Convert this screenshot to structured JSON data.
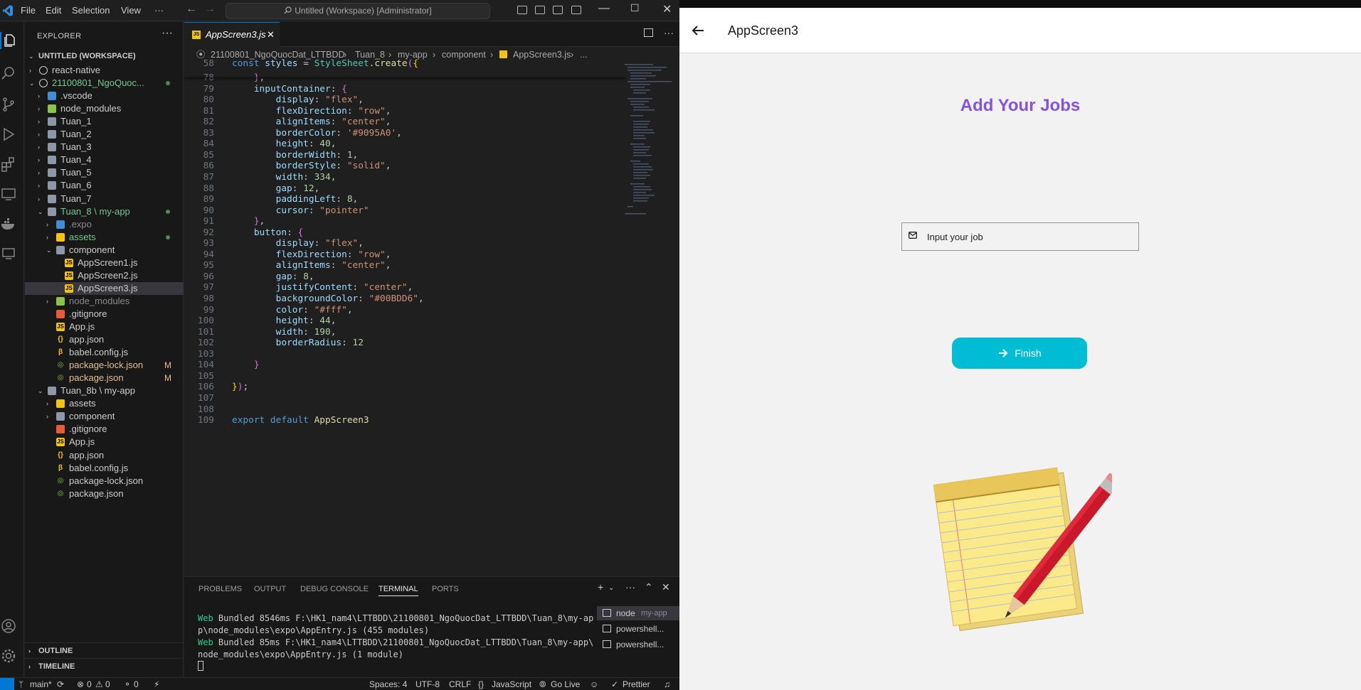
{
  "vscode": {
    "menu": [
      "File",
      "Edit",
      "Selection",
      "View",
      "···"
    ],
    "command_center": "Untitled (Workspace) [Administrator]",
    "explorer_title": "EXPLORER",
    "explorer_more": "···",
    "workspace_label": "UNTITLED (WORKSPACE)",
    "tree": [
      {
        "label": "react-native",
        "depth": 1,
        "chev": "›",
        "icon": "root"
      },
      {
        "label": "21100801_NgoQuoc...",
        "depth": 1,
        "chev": "⌄",
        "icon": "root",
        "dot": true,
        "color": "#73c991"
      },
      {
        "label": ".vscode",
        "depth": 2,
        "chev": "›",
        "icon": "vscode-folder"
      },
      {
        "label": "node_modules",
        "depth": 2,
        "chev": "›",
        "icon": "node-folder"
      },
      {
        "label": "Tuan_1",
        "depth": 2,
        "chev": "›",
        "icon": "folder"
      },
      {
        "label": "Tuan_2",
        "depth": 2,
        "chev": "›",
        "icon": "folder"
      },
      {
        "label": "Tuan_3",
        "depth": 2,
        "chev": "›",
        "icon": "folder"
      },
      {
        "label": "Tuan_4",
        "depth": 2,
        "chev": "›",
        "icon": "folder"
      },
      {
        "label": "Tuan_5",
        "depth": 2,
        "chev": "›",
        "icon": "folder"
      },
      {
        "label": "Tuan_6",
        "depth": 2,
        "chev": "›",
        "icon": "folder"
      },
      {
        "label": "Tuan_7",
        "depth": 2,
        "chev": "›",
        "icon": "folder"
      },
      {
        "label": "Tuan_8 \\ my-app",
        "depth": 2,
        "chev": "⌄",
        "icon": "folder-open",
        "dot": true,
        "color": "#73c991"
      },
      {
        "label": ".expo",
        "depth": 3,
        "chev": "›",
        "icon": "expo-folder",
        "color": "#8b8b8b"
      },
      {
        "label": "assets",
        "depth": 3,
        "chev": "›",
        "icon": "assets-folder",
        "dot": true,
        "color": "#73c991"
      },
      {
        "label": "component",
        "depth": 3,
        "chev": "⌄",
        "icon": "folder-open"
      },
      {
        "label": "AppScreen1.js",
        "depth": 4,
        "chev": "",
        "icon": "js"
      },
      {
        "label": "AppScreen2.js",
        "depth": 4,
        "chev": "",
        "icon": "js"
      },
      {
        "label": "AppScreen3.js",
        "depth": 4,
        "chev": "",
        "icon": "js",
        "selected": true
      },
      {
        "label": "node_modules",
        "depth": 3,
        "chev": "›",
        "icon": "node-folder",
        "color": "#8b8b8b"
      },
      {
        "label": ".gitignore",
        "depth": 3,
        "chev": "",
        "icon": "git"
      },
      {
        "label": "App.js",
        "depth": 3,
        "chev": "",
        "icon": "js"
      },
      {
        "label": "app.json",
        "depth": 3,
        "chev": "",
        "icon": "json"
      },
      {
        "label": "babel.config.js",
        "depth": 3,
        "chev": "",
        "icon": "babel"
      },
      {
        "label": "package-lock.json",
        "depth": 3,
        "chev": "",
        "icon": "npm",
        "mod": "M",
        "color": "#e2c08d"
      },
      {
        "label": "package.json",
        "depth": 3,
        "chev": "",
        "icon": "npm",
        "mod": "M",
        "color": "#e2c08d"
      },
      {
        "label": "Tuan_8b \\ my-app",
        "depth": 2,
        "chev": "⌄",
        "icon": "folder-open"
      },
      {
        "label": "assets",
        "depth": 3,
        "chev": "›",
        "icon": "assets-folder"
      },
      {
        "label": "component",
        "depth": 3,
        "chev": "›",
        "icon": "folder"
      },
      {
        "label": ".gitignore",
        "depth": 3,
        "chev": "",
        "icon": "git"
      },
      {
        "label": "App.js",
        "depth": 3,
        "chev": "",
        "icon": "js"
      },
      {
        "label": "app.json",
        "depth": 3,
        "chev": "",
        "icon": "json"
      },
      {
        "label": "babel.config.js",
        "depth": 3,
        "chev": "",
        "icon": "babel"
      },
      {
        "label": "package-lock.json",
        "depth": 3,
        "chev": "",
        "icon": "npm"
      },
      {
        "label": "package.json",
        "depth": 3,
        "chev": "",
        "icon": "npm"
      }
    ],
    "outline_label": "OUTLINE",
    "timeline_label": "TIMELINE",
    "tab_label": "AppScreen3.js",
    "tab_close": "✕",
    "breadcrumb": [
      "21100801_NgoQuocDat_LTTBDD",
      "Tuan_8",
      "my-app",
      "component",
      "AppScreen3.js",
      "..."
    ],
    "code_lines": [
      {
        "n": "58",
        "html": "<span class=\"k\">const</span> <span class=\"p\">styles</span> = <span class=\"c\">StyleSheet</span>.<span class=\"f\">create</span><span class=\"br\">(</span><span class=\"br2\">{</span>"
      },
      {
        "n": "78",
        "html": "    <span class=\"br\">}</span>,"
      },
      {
        "n": "79",
        "html": "    <span class=\"p\">inputContainer</span>: <span class=\"br\">{</span>"
      },
      {
        "n": "80",
        "html": "        <span class=\"p\">display</span>: <span class=\"s\">\"flex\"</span>,"
      },
      {
        "n": "81",
        "html": "        <span class=\"p\">flexDirection</span>: <span class=\"s\">\"row\"</span>,"
      },
      {
        "n": "82",
        "html": "        <span class=\"p\">alignItems</span>: <span class=\"s\">\"center\"</span>,"
      },
      {
        "n": "83",
        "html": "        <span class=\"p\">borderColor</span>: <span class=\"s\">'#9095A0'</span>,"
      },
      {
        "n": "84",
        "html": "        <span class=\"p\">height</span>: <span class=\"n\">40</span>,"
      },
      {
        "n": "85",
        "html": "        <span class=\"p\">borderWidth</span>: <span class=\"n\">1</span>,"
      },
      {
        "n": "86",
        "html": "        <span class=\"p\">borderStyle</span>: <span class=\"s\">\"solid\"</span>,"
      },
      {
        "n": "87",
        "html": "        <span class=\"p\">width</span>: <span class=\"n\">334</span>,"
      },
      {
        "n": "88",
        "html": "        <span class=\"p\">gap</span>: <span class=\"n\">12</span>,"
      },
      {
        "n": "89",
        "html": "        <span class=\"p\">paddingLeft</span>: <span class=\"n\">8</span>,"
      },
      {
        "n": "90",
        "html": "        <span class=\"p\">cursor</span>: <span class=\"s\">\"pointer\"</span>"
      },
      {
        "n": "91",
        "html": "    <span class=\"br\">}</span>,"
      },
      {
        "n": "92",
        "html": "    <span class=\"p\">button</span>: <span class=\"br\">{</span>"
      },
      {
        "n": "93",
        "html": "        <span class=\"p\">display</span>: <span class=\"s\">\"flex\"</span>,"
      },
      {
        "n": "94",
        "html": "        <span class=\"p\">flexDirection</span>: <span class=\"s\">\"row\"</span>,"
      },
      {
        "n": "95",
        "html": "        <span class=\"p\">alignItems</span>: <span class=\"s\">\"center\"</span>,"
      },
      {
        "n": "96",
        "html": "        <span class=\"p\">gap</span>: <span class=\"n\">8</span>,"
      },
      {
        "n": "97",
        "html": "        <span class=\"p\">justifyContent</span>: <span class=\"s\">\"center\"</span>,"
      },
      {
        "n": "98",
        "html": "        <span class=\"p\">backgroundColor</span>: <span class=\"s\">\"#00BDD6\"</span>,"
      },
      {
        "n": "99",
        "html": "        <span class=\"p\">color</span>: <span class=\"s\">\"#fff\"</span>,"
      },
      {
        "n": "100",
        "html": "        <span class=\"p\">height</span>: <span class=\"n\">44</span>,"
      },
      {
        "n": "101",
        "html": "        <span class=\"p\">width</span>: <span class=\"n\">190</span>,"
      },
      {
        "n": "102",
        "html": "        <span class=\"p\">borderRadius</span>: <span class=\"n\">12</span>"
      },
      {
        "n": "103",
        "html": ""
      },
      {
        "n": "104",
        "html": "    <span class=\"br\">}</span>"
      },
      {
        "n": "105",
        "html": ""
      },
      {
        "n": "106",
        "html": "<span class=\"br2\">}</span><span class=\"br\">)</span>;"
      },
      {
        "n": "107",
        "html": ""
      },
      {
        "n": "108",
        "html": ""
      },
      {
        "n": "109",
        "html": "<span class=\"k\">export default</span> <span class=\"f\">AppScreen3</span>"
      }
    ],
    "panel_tabs": [
      "PROBLEMS",
      "OUTPUT",
      "DEBUG CONSOLE",
      "TERMINAL",
      "PORTS"
    ],
    "panel_active": "TERMINAL",
    "terminal_lines": [
      {
        "tag": "Web",
        "rest": " Bundled 8546ms F:\\HK1_nam4\\LTTBDD\\21100801_NgoQuocDat_LTTBDD\\Tuan_8\\my-ap"
      },
      {
        "tag": "",
        "rest": "p\\node_modules\\expo\\AppEntry.js (455 modules)"
      },
      {
        "tag": "Web",
        "rest": " Bundled 85ms F:\\HK1_nam4\\LTTBDD\\21100801_NgoQuocDat_LTTBDD\\Tuan_8\\my-app\\"
      },
      {
        "tag": "",
        "rest": "node_modules\\expo\\AppEntry.js (1 module)"
      }
    ],
    "terminal_list": [
      {
        "name": "node",
        "sub": "my-app",
        "selected": true
      },
      {
        "name": "powershell...",
        "sub": ""
      },
      {
        "name": "powershell...",
        "sub": ""
      }
    ],
    "status": {
      "branch": "main*",
      "errors": "0",
      "warnings": "0",
      "ports": "0",
      "spaces": "Spaces: 4",
      "encoding": "UTF-8",
      "eol": "CRLF",
      "language": "JavaScript",
      "golive": "Go Live",
      "prettier": "Prettier"
    }
  },
  "app": {
    "header_title": "AppScreen3",
    "heading": "Add Your Jobs",
    "input_placeholder": "Input your job",
    "finish_label": "Finish",
    "accent": "#8353E2",
    "button_color": "#00BDD6"
  }
}
